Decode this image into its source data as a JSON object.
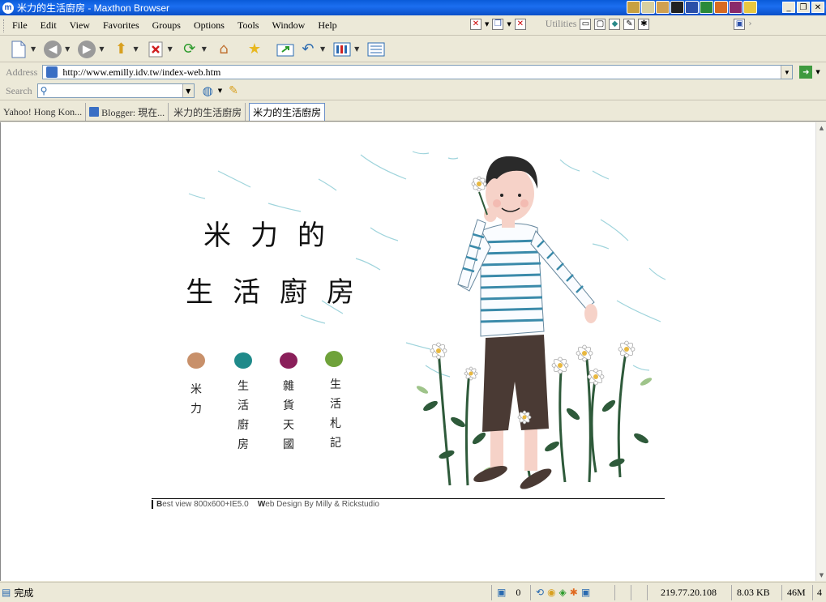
{
  "window": {
    "title": "米力的生活廚房 - Maxthon Browser",
    "controls": {
      "minimize": "_",
      "restore": "❐",
      "close": "✕"
    }
  },
  "menu": {
    "items": [
      "File",
      "Edit",
      "View",
      "Favorites",
      "Groups",
      "Options",
      "Tools",
      "Window",
      "Help"
    ],
    "utilities_label": "Utilities"
  },
  "address": {
    "label": "Address",
    "url": "http://www.emilly.idv.tw/index-web.htm"
  },
  "search": {
    "label": "Search",
    "value": ""
  },
  "tabs": [
    {
      "label": "Yahoo! Hong Kon...",
      "active": false
    },
    {
      "label": "Blogger: 現在...",
      "active": false
    },
    {
      "label": "米力的生活廚房",
      "active": false
    },
    {
      "label": "米力的生活廚房",
      "active": true
    }
  ],
  "page": {
    "title_line1": "米力的",
    "title_line2": "生活廚房",
    "nav": [
      {
        "label": "米力",
        "color": "#c8906a"
      },
      {
        "label": "生活廚房",
        "color": "#1f8a8a"
      },
      {
        "label": "雜貨天國",
        "color": "#8a1f5a"
      },
      {
        "label": "生活札記",
        "color": "#6fa23a"
      }
    ],
    "footer": {
      "best_view_initial": "B",
      "best_view_rest": "est view 800x600+IE5.0",
      "design_initial": "W",
      "design_rest": "eb Design By Milly & Rickstudio"
    }
  },
  "status": {
    "text": "完成",
    "popup_count": "0",
    "ip": "219.77.20.108",
    "size": "8.03 KB",
    "memory": "46M",
    "extra": "4"
  }
}
